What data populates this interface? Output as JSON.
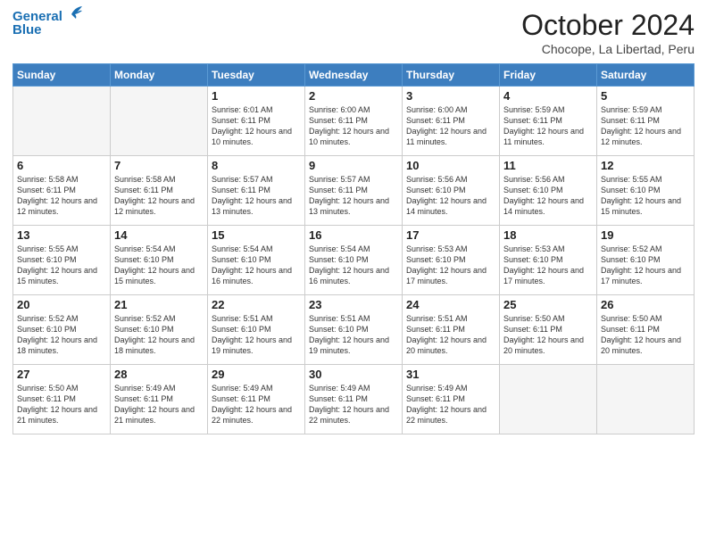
{
  "logo": {
    "line1": "General",
    "line2": "Blue"
  },
  "header": {
    "title": "October 2024",
    "location": "Chocope, La Libertad, Peru"
  },
  "weekdays": [
    "Sunday",
    "Monday",
    "Tuesday",
    "Wednesday",
    "Thursday",
    "Friday",
    "Saturday"
  ],
  "weeks": [
    [
      {
        "day": "",
        "sunrise": "",
        "sunset": "",
        "daylight": ""
      },
      {
        "day": "",
        "sunrise": "",
        "sunset": "",
        "daylight": ""
      },
      {
        "day": "1",
        "sunrise": "Sunrise: 6:01 AM",
        "sunset": "Sunset: 6:11 PM",
        "daylight": "Daylight: 12 hours and 10 minutes."
      },
      {
        "day": "2",
        "sunrise": "Sunrise: 6:00 AM",
        "sunset": "Sunset: 6:11 PM",
        "daylight": "Daylight: 12 hours and 10 minutes."
      },
      {
        "day": "3",
        "sunrise": "Sunrise: 6:00 AM",
        "sunset": "Sunset: 6:11 PM",
        "daylight": "Daylight: 12 hours and 11 minutes."
      },
      {
        "day": "4",
        "sunrise": "Sunrise: 5:59 AM",
        "sunset": "Sunset: 6:11 PM",
        "daylight": "Daylight: 12 hours and 11 minutes."
      },
      {
        "day": "5",
        "sunrise": "Sunrise: 5:59 AM",
        "sunset": "Sunset: 6:11 PM",
        "daylight": "Daylight: 12 hours and 12 minutes."
      }
    ],
    [
      {
        "day": "6",
        "sunrise": "Sunrise: 5:58 AM",
        "sunset": "Sunset: 6:11 PM",
        "daylight": "Daylight: 12 hours and 12 minutes."
      },
      {
        "day": "7",
        "sunrise": "Sunrise: 5:58 AM",
        "sunset": "Sunset: 6:11 PM",
        "daylight": "Daylight: 12 hours and 12 minutes."
      },
      {
        "day": "8",
        "sunrise": "Sunrise: 5:57 AM",
        "sunset": "Sunset: 6:11 PM",
        "daylight": "Daylight: 12 hours and 13 minutes."
      },
      {
        "day": "9",
        "sunrise": "Sunrise: 5:57 AM",
        "sunset": "Sunset: 6:11 PM",
        "daylight": "Daylight: 12 hours and 13 minutes."
      },
      {
        "day": "10",
        "sunrise": "Sunrise: 5:56 AM",
        "sunset": "Sunset: 6:10 PM",
        "daylight": "Daylight: 12 hours and 14 minutes."
      },
      {
        "day": "11",
        "sunrise": "Sunrise: 5:56 AM",
        "sunset": "Sunset: 6:10 PM",
        "daylight": "Daylight: 12 hours and 14 minutes."
      },
      {
        "day": "12",
        "sunrise": "Sunrise: 5:55 AM",
        "sunset": "Sunset: 6:10 PM",
        "daylight": "Daylight: 12 hours and 15 minutes."
      }
    ],
    [
      {
        "day": "13",
        "sunrise": "Sunrise: 5:55 AM",
        "sunset": "Sunset: 6:10 PM",
        "daylight": "Daylight: 12 hours and 15 minutes."
      },
      {
        "day": "14",
        "sunrise": "Sunrise: 5:54 AM",
        "sunset": "Sunset: 6:10 PM",
        "daylight": "Daylight: 12 hours and 15 minutes."
      },
      {
        "day": "15",
        "sunrise": "Sunrise: 5:54 AM",
        "sunset": "Sunset: 6:10 PM",
        "daylight": "Daylight: 12 hours and 16 minutes."
      },
      {
        "day": "16",
        "sunrise": "Sunrise: 5:54 AM",
        "sunset": "Sunset: 6:10 PM",
        "daylight": "Daylight: 12 hours and 16 minutes."
      },
      {
        "day": "17",
        "sunrise": "Sunrise: 5:53 AM",
        "sunset": "Sunset: 6:10 PM",
        "daylight": "Daylight: 12 hours and 17 minutes."
      },
      {
        "day": "18",
        "sunrise": "Sunrise: 5:53 AM",
        "sunset": "Sunset: 6:10 PM",
        "daylight": "Daylight: 12 hours and 17 minutes."
      },
      {
        "day": "19",
        "sunrise": "Sunrise: 5:52 AM",
        "sunset": "Sunset: 6:10 PM",
        "daylight": "Daylight: 12 hours and 17 minutes."
      }
    ],
    [
      {
        "day": "20",
        "sunrise": "Sunrise: 5:52 AM",
        "sunset": "Sunset: 6:10 PM",
        "daylight": "Daylight: 12 hours and 18 minutes."
      },
      {
        "day": "21",
        "sunrise": "Sunrise: 5:52 AM",
        "sunset": "Sunset: 6:10 PM",
        "daylight": "Daylight: 12 hours and 18 minutes."
      },
      {
        "day": "22",
        "sunrise": "Sunrise: 5:51 AM",
        "sunset": "Sunset: 6:10 PM",
        "daylight": "Daylight: 12 hours and 19 minutes."
      },
      {
        "day": "23",
        "sunrise": "Sunrise: 5:51 AM",
        "sunset": "Sunset: 6:10 PM",
        "daylight": "Daylight: 12 hours and 19 minutes."
      },
      {
        "day": "24",
        "sunrise": "Sunrise: 5:51 AM",
        "sunset": "Sunset: 6:11 PM",
        "daylight": "Daylight: 12 hours and 20 minutes."
      },
      {
        "day": "25",
        "sunrise": "Sunrise: 5:50 AM",
        "sunset": "Sunset: 6:11 PM",
        "daylight": "Daylight: 12 hours and 20 minutes."
      },
      {
        "day": "26",
        "sunrise": "Sunrise: 5:50 AM",
        "sunset": "Sunset: 6:11 PM",
        "daylight": "Daylight: 12 hours and 20 minutes."
      }
    ],
    [
      {
        "day": "27",
        "sunrise": "Sunrise: 5:50 AM",
        "sunset": "Sunset: 6:11 PM",
        "daylight": "Daylight: 12 hours and 21 minutes."
      },
      {
        "day": "28",
        "sunrise": "Sunrise: 5:49 AM",
        "sunset": "Sunset: 6:11 PM",
        "daylight": "Daylight: 12 hours and 21 minutes."
      },
      {
        "day": "29",
        "sunrise": "Sunrise: 5:49 AM",
        "sunset": "Sunset: 6:11 PM",
        "daylight": "Daylight: 12 hours and 22 minutes."
      },
      {
        "day": "30",
        "sunrise": "Sunrise: 5:49 AM",
        "sunset": "Sunset: 6:11 PM",
        "daylight": "Daylight: 12 hours and 22 minutes."
      },
      {
        "day": "31",
        "sunrise": "Sunrise: 5:49 AM",
        "sunset": "Sunset: 6:11 PM",
        "daylight": "Daylight: 12 hours and 22 minutes."
      },
      {
        "day": "",
        "sunrise": "",
        "sunset": "",
        "daylight": ""
      },
      {
        "day": "",
        "sunrise": "",
        "sunset": "",
        "daylight": ""
      }
    ]
  ]
}
